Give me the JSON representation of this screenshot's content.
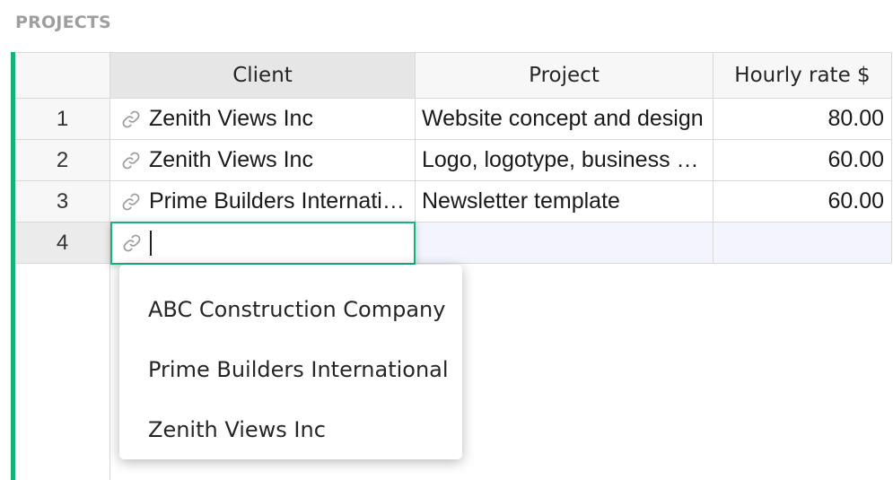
{
  "section": {
    "title": "PROJECTS"
  },
  "colors": {
    "accent": "#16b378",
    "header_bg": "#f7f7f7",
    "active_row_bg": "#f4f4fd",
    "grid_line": "#d9d9d9"
  },
  "columns": {
    "client": "Client",
    "project": "Project",
    "rate": "Hourly rate $"
  },
  "rows": [
    {
      "num": "1",
      "client": "Zenith Views Inc",
      "project": "Website concept and design",
      "rate": "80.00"
    },
    {
      "num": "2",
      "client": "Zenith Views Inc",
      "project": "Logo, logotype, business cards",
      "rate": "60.00"
    },
    {
      "num": "3",
      "client": "Prime Builders International",
      "project": "Newsletter template",
      "rate": "60.00"
    }
  ],
  "new_row": {
    "num": "4",
    "client_value": ""
  },
  "icons": {
    "reference": "link-icon"
  },
  "dropdown": {
    "options": [
      "ABC Construction Company",
      "Prime Builders International",
      "Zenith Views Inc"
    ]
  }
}
